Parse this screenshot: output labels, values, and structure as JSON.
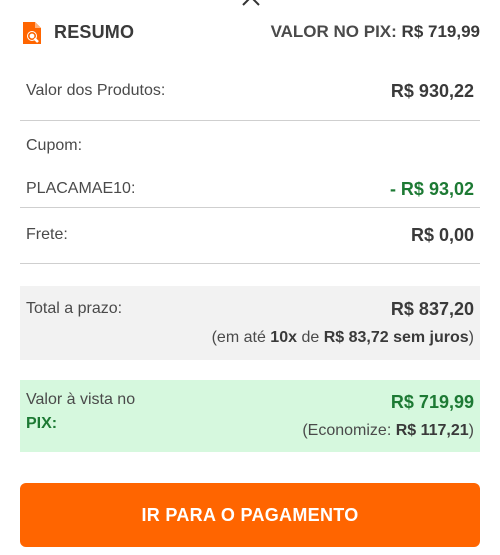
{
  "header": {
    "title": "RESUMO",
    "pix_label": "VALOR NO PIX:",
    "pix_value": "R$ 719,99"
  },
  "rows": {
    "produtos_label": "Valor dos Produtos:",
    "produtos_value": "R$ 930,22",
    "cupom_label": "Cupom:",
    "cupom_code": "PLACAMAE10:",
    "cupom_value": "- R$ 93,02",
    "frete_label": "Frete:",
    "frete_value": "R$ 0,00"
  },
  "prazo": {
    "label": "Total a prazo:",
    "value": "R$ 837,20",
    "installments_prefix": "(em até",
    "installments_count": "10x",
    "installments_mid": "de",
    "installments_detail": "R$ 83,72 sem juros",
    "installments_suffix": ")"
  },
  "vista": {
    "label_line1": "Valor à vista no",
    "label_line2": "PIX:",
    "value": "R$ 719,99",
    "savings_prefix": "(Economize:",
    "savings_value": "R$ 117,21",
    "savings_suffix": ")"
  },
  "cta": {
    "label": "IR PARA O PAGAMENTO"
  },
  "icons": {
    "summary": "document-search-icon",
    "close": "close-icon"
  },
  "colors": {
    "accent": "#ff6500",
    "discount": "#1d7a34",
    "pix_box": "#d6f8de"
  }
}
